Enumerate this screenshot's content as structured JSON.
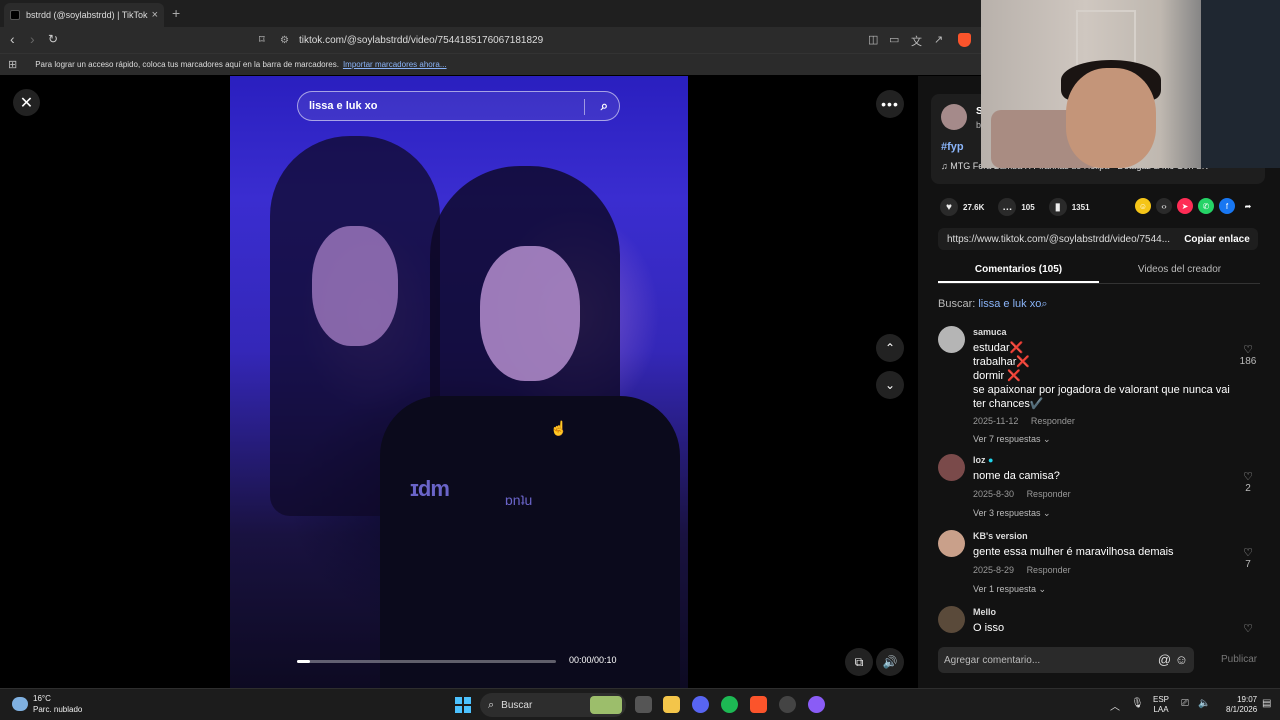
{
  "browser": {
    "tab_title": "bstrdd (@soylabstrdd) | TikTok",
    "tab_close": "×",
    "new_tab": "+",
    "url": "tiktok.com/@soylabstrdd/video/7544185176067181829",
    "bookmarks_message": "Para lograr un acceso rápido, coloca tus marcadores aquí en la barra de marcadores.",
    "bookmarks_link": "Importar marcadores ahora..."
  },
  "video": {
    "search_text": "lissa e luk xo",
    "time": "00:00/00:10",
    "progress": 0.05,
    "jacket_logo": "ɪdm",
    "jacket_logo2": "ɒnʇu"
  },
  "panel": {
    "creator_initial": "S",
    "creator_sub": "b",
    "hashtag": "#fyp",
    "music": "♫  MTG Fera Bamba X Piranhas do Helipa - Detagaz & Mc Gorl SK",
    "likes": "27.6K",
    "comments_count": "105",
    "saves": "1351",
    "link_url": "https://www.tiktok.com/@soylabstrdd/video/7544...",
    "copy_label": "Copiar enlace",
    "tab_comments": "Comentarios (105)",
    "tab_creator": "Videos del creador",
    "search_prefix": "Buscar:",
    "search_term": "lissa e luk xo",
    "comments": [
      {
        "user": "samuca",
        "lines": [
          "estudar❌",
          "trabalhar❌",
          "dormir ❌",
          "se apaixonar por jogadora de valorant que nunca vai",
          "ter chances✔️"
        ],
        "date": "2025-11-12",
        "reply": "Responder",
        "more": "Ver 7 respuestas ⌄",
        "likes": "186"
      },
      {
        "user": "loz",
        "lines": [
          "nome da camisa?"
        ],
        "date": "2025-8-30",
        "reply": "Responder",
        "more": "Ver 3 respuestas ⌄",
        "likes": "2"
      },
      {
        "user": "KB's version",
        "lines": [
          "gente essa mulher é maravilhosa demais"
        ],
        "date": "2025-8-29",
        "reply": "Responder",
        "more": "Ver 1 respuesta ⌄",
        "likes": "7"
      },
      {
        "user": "Mello",
        "lines": [
          "O isso"
        ],
        "date": "",
        "reply": "",
        "more": "",
        "likes": ""
      }
    ],
    "add_comment_placeholder": "Agregar comentario...",
    "publish": "Publicar"
  },
  "taskbar": {
    "temp": "16°C",
    "weather": "Parc. nublado",
    "search": "Buscar",
    "lang1": "ESP",
    "lang2": "LAA",
    "time": "19:07",
    "date": "8/1/2026"
  },
  "colors": {
    "accent_link": "#8ab4f8",
    "video_purple": "#3a2dd0",
    "panel_bg": "#121212"
  }
}
